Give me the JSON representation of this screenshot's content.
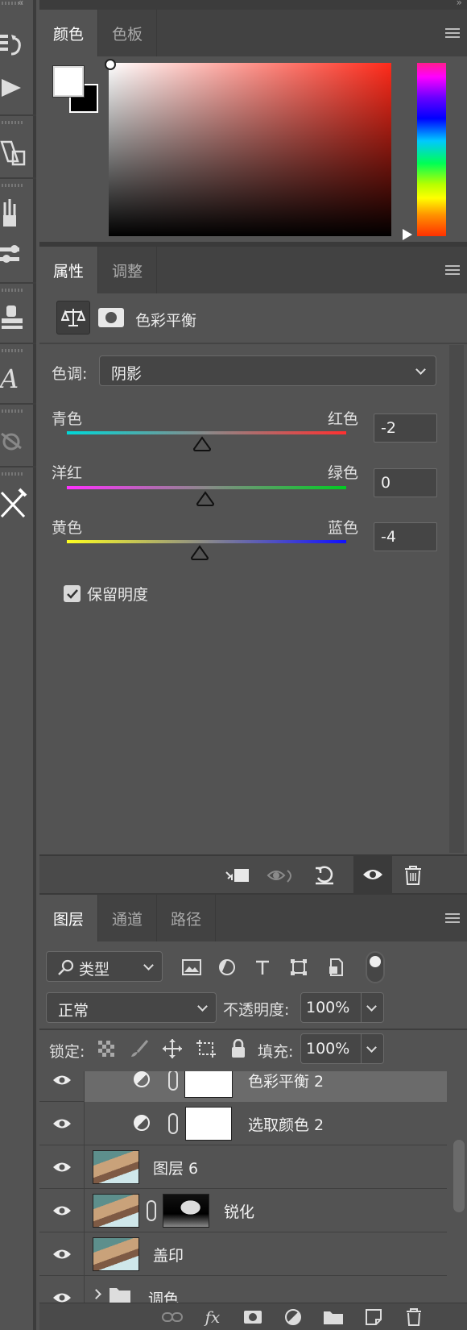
{
  "color_panel": {
    "tabs": [
      {
        "label": "颜色",
        "active": true
      },
      {
        "label": "色板",
        "active": false
      }
    ],
    "foreground": "#ffffff",
    "background": "#000000",
    "field_hue": "#ff2a1a"
  },
  "properties_panel": {
    "tabs": [
      {
        "label": "属性",
        "active": true
      },
      {
        "label": "调整",
        "active": false
      }
    ],
    "title": "色彩平衡",
    "tone": {
      "label": "色调:",
      "value": "阴影"
    },
    "sliders": [
      {
        "left_label": "青色",
        "right_label": "红色",
        "value": "-2",
        "left_color": "#00d8d8",
        "right_color": "#ff3030"
      },
      {
        "left_label": "洋红",
        "right_label": "绿色",
        "value": "0",
        "left_color": "#ff30ff",
        "right_color": "#00cc22"
      },
      {
        "left_label": "黄色",
        "right_label": "蓝色",
        "value": "-4",
        "left_color": "#ffff20",
        "right_color": "#1010ff"
      }
    ],
    "preserve_luminosity": {
      "label": "保留明度",
      "checked": true
    },
    "footer_icons": [
      "clip-to-layer-icon",
      "view-previous-state-icon",
      "reset-icon",
      "visibility-icon",
      "delete-icon"
    ]
  },
  "layers_panel": {
    "tabs": [
      {
        "label": "图层",
        "active": true
      },
      {
        "label": "通道",
        "active": false
      },
      {
        "label": "路径",
        "active": false
      }
    ],
    "filter": {
      "label": "类型"
    },
    "blend_mode": "正常",
    "opacity": {
      "label": "不透明度:",
      "value": "100%"
    },
    "lock": {
      "label": "锁定:"
    },
    "fill": {
      "label": "填充:",
      "value": "100%"
    },
    "layers": [
      {
        "name": "色彩平衡 2",
        "kind": "adjustment",
        "selected": true
      },
      {
        "name": "选取颜色 2",
        "kind": "adjustment",
        "selected": false
      },
      {
        "name": "图层 6",
        "kind": "pixel",
        "selected": false
      },
      {
        "name": "锐化",
        "kind": "pixel-mask",
        "selected": false
      },
      {
        "name": "盖印",
        "kind": "pixel",
        "selected": false
      },
      {
        "name": "调色",
        "kind": "group",
        "selected": false
      }
    ],
    "footer_icons": [
      "link-layers-icon",
      "fx-icon",
      "add-mask-icon",
      "new-adjustment-icon",
      "new-group-icon",
      "new-layer-icon",
      "delete-layer-icon"
    ]
  }
}
